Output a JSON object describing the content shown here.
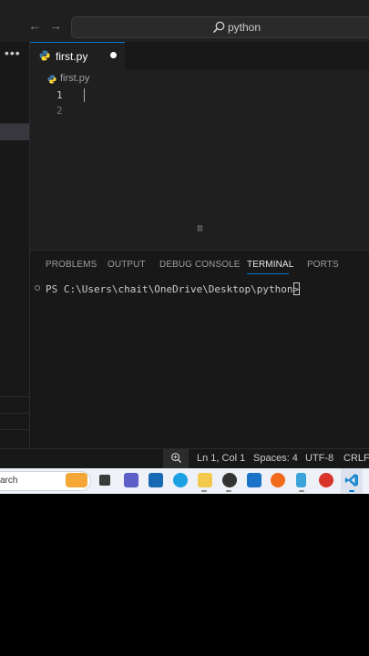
{
  "titlebar": {
    "search_text": "python"
  },
  "tab": {
    "label": "first.py"
  },
  "breadcrumb": {
    "file": "first.py"
  },
  "editor": {
    "line_numbers": [
      "1",
      "2"
    ]
  },
  "panel": {
    "tabs": [
      "PROBLEMS",
      "OUTPUT",
      "DEBUG CONSOLE",
      "TERMINAL",
      "PORTS"
    ],
    "active_tab": "TERMINAL",
    "terminal_prompt": "PS C:\\Users\\chait\\OneDrive\\Desktop\\python>"
  },
  "statusbar": {
    "position": "Ln 1, Col 1",
    "spaces": "Spaces: 4",
    "encoding": "UTF-8",
    "eol": "CRLF"
  },
  "taskbar": {
    "search_text": "arch",
    "icons": [
      "widgets-icon",
      "task-view-icon",
      "teams-icon",
      "dell-icon",
      "edge-icon",
      "file-explorer-icon",
      "chrome-icon",
      "store-icon",
      "firefox-icon",
      "notepad-icon",
      "wps-icon",
      "vscode-icon"
    ]
  },
  "colors": {
    "accent": "#0078d4",
    "editor_bg": "#1f1f1f",
    "panel_bg": "#181818",
    "taskbar_bg": "#eef2f8"
  }
}
